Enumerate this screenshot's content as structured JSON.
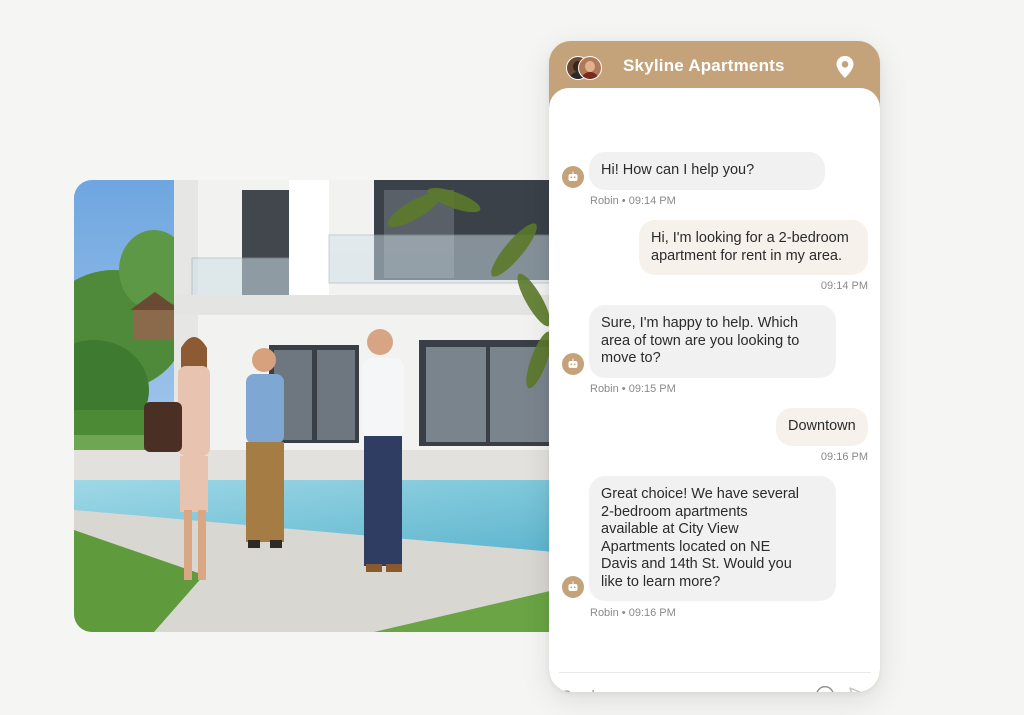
{
  "chat": {
    "title": "Skyline Apartments",
    "brand_color": "#c4a27a",
    "header_icons": [
      "agent-avatars",
      "location-pin-icon"
    ],
    "messages": [
      {
        "from": "bot",
        "text": "Hi! How can I help you?",
        "meta": "Robin • 09:14 PM"
      },
      {
        "from": "user",
        "line1": "Hi, I'm looking for a 2-bedroom",
        "line2": "apartment for rent in my area.",
        "meta": "09:14 PM"
      },
      {
        "from": "bot",
        "line1": "Sure, I'm happy to help. Which",
        "line2": "area of town are you looking to",
        "line3": "move to?",
        "meta": "Robin • 09:15 PM"
      },
      {
        "from": "user",
        "text": "Downtown",
        "meta": "09:16 PM"
      },
      {
        "from": "bot",
        "line1": "Great choice! We have several",
        "line2": "2-bedroom apartments",
        "line3": "available at City View",
        "line4": "Apartments located on NE",
        "line5": "Davis and 14th St. Would you",
        "line6": "like to learn more?",
        "meta": "Robin • 09:16 PM"
      }
    ],
    "composer": {
      "placeholder": "Send a message...",
      "icons": [
        "emoji-icon",
        "send-icon"
      ]
    }
  }
}
